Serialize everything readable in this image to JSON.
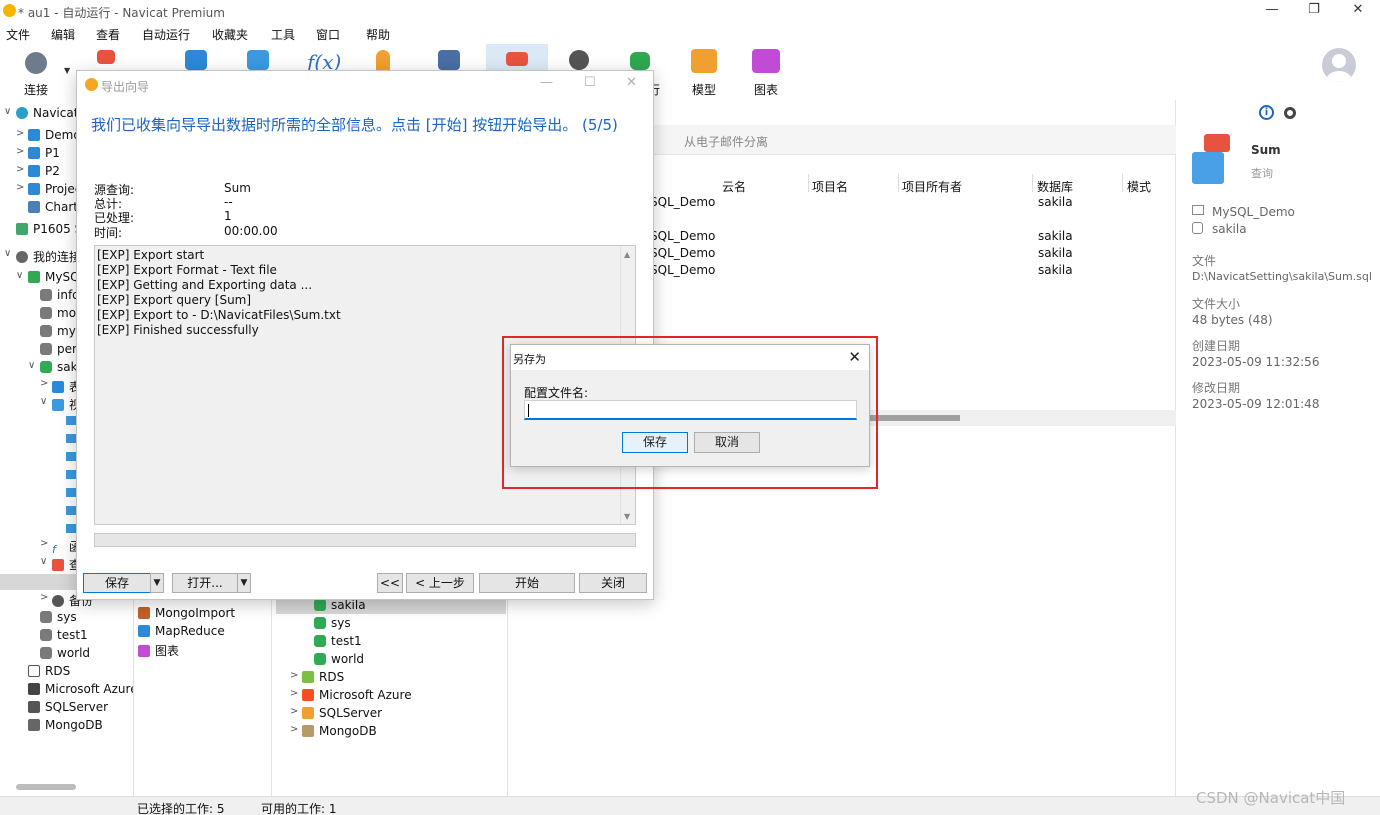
{
  "window": {
    "title": "* au1 - 自动运行 - Navicat Premium",
    "min": "—",
    "max": "❐",
    "close": "✕"
  },
  "menu": [
    "文件",
    "编辑",
    "查看",
    "自动运行",
    "收藏夹",
    "工具",
    "窗口",
    "帮助"
  ],
  "toolbar": {
    "connect": "连接",
    "run": "行",
    "model": "模型",
    "chart": "图表"
  },
  "nav": {
    "items": [
      {
        "label": "Navicat",
        "chevron": "∨"
      },
      {
        "label": "Demo",
        "chevron": ">"
      },
      {
        "label": "P1",
        "chevron": ">"
      },
      {
        "label": "P2",
        "chevron": ">"
      },
      {
        "label": "Projec",
        "chevron": ">"
      },
      {
        "label": "Chart",
        "chevron": ""
      },
      {
        "label": "P1605 S",
        "chevron": ""
      },
      {
        "label": "我的连接",
        "chevron": "∨"
      },
      {
        "label": "MySQL",
        "chevron": "∨"
      },
      {
        "label": "info",
        "chevron": ""
      },
      {
        "label": "mo",
        "chevron": ""
      },
      {
        "label": "my",
        "chevron": ""
      },
      {
        "label": "per",
        "chevron": ""
      },
      {
        "label": "sak",
        "chevron": "∨"
      },
      {
        "label": "表",
        "chevron": ">"
      },
      {
        "label": "视",
        "chevron": "∨"
      },
      {
        "label": "函",
        "chevron": ">"
      },
      {
        "label": "查",
        "chevron": "∨"
      },
      {
        "label": "备份",
        "chevron": ">"
      },
      {
        "label": "sys",
        "chevron": ""
      },
      {
        "label": "test1",
        "chevron": ""
      },
      {
        "label": "world",
        "chevron": ""
      },
      {
        "label": "RDS",
        "chevron": ""
      },
      {
        "label": "Microsoft Azure",
        "chevron": ""
      },
      {
        "label": "SQLServer",
        "chevron": ""
      },
      {
        "label": "MongoDB",
        "chevron": ""
      }
    ]
  },
  "objects": {
    "items": [
      "MongoImport",
      "MapReduce",
      "图表"
    ]
  },
  "panel2": {
    "items": [
      {
        "label": "sakila",
        "chevron": ""
      },
      {
        "label": "sys",
        "chevron": ""
      },
      {
        "label": "test1",
        "chevron": ""
      },
      {
        "label": "world",
        "chevron": ""
      },
      {
        "label": "RDS",
        "chevron": ">"
      },
      {
        "label": "Microsoft Azure",
        "chevron": ">"
      },
      {
        "label": "SQLServer",
        "chevron": ">"
      },
      {
        "label": "MongoDB",
        "chevron": ">"
      }
    ]
  },
  "main": {
    "toolbar_text": "从电子邮件分离",
    "columns": [
      "云名",
      "项目名",
      "项目所有者",
      "数据库",
      "模式"
    ],
    "rows": [
      {
        "conn": "SQL_Demo",
        "db": "sakila"
      },
      {
        "conn": "SQL_Demo",
        "db": "sakila"
      },
      {
        "conn": "SQL_Demo",
        "db": "sakila"
      },
      {
        "conn": "SQL_Demo",
        "db": "sakila"
      }
    ]
  },
  "info": {
    "name": "Sum",
    "type": "查询",
    "connection": "MySQL_Demo",
    "database": "sakila",
    "file_label": "文件",
    "file_value": "D:\\NavicatSetting\\sakila\\Sum.sql",
    "size_label": "文件大小",
    "size_value": "48 bytes (48)",
    "created_label": "创建日期",
    "created_value": "2023-05-09 11:32:56",
    "modified_label": "修改日期",
    "modified_value": "2023-05-09 12:01:48"
  },
  "status": {
    "selected": "已选择的工作: 5",
    "available": "可用的工作: 1"
  },
  "watermark": "CSDN @Navicat中国",
  "wizard": {
    "title": "导出向导",
    "heading": "我们已收集向导导出数据时所需的全部信息。点击 [开始] 按钮开始导出。 (5/5)",
    "summary": [
      {
        "key": "源查询:",
        "value": "Sum"
      },
      {
        "key": "总计:",
        "value": "--"
      },
      {
        "key": "已处理:",
        "value": "1"
      },
      {
        "key": "时间:",
        "value": "00:00.00"
      }
    ],
    "log": [
      "[EXP] Export start",
      "[EXP] Export Format - Text file",
      "[EXP] Getting and Exporting data ...",
      "[EXP] Export query [Sum]",
      "[EXP] Export to - D:\\NavicatFiles\\Sum.txt",
      "[EXP] Finished successfully"
    ],
    "progress": 0,
    "buttons": {
      "save": "保存",
      "open": "打开...",
      "first": "<<",
      "back": "< 上一步",
      "start": "开始",
      "close": "关闭"
    }
  },
  "saveas": {
    "title": "另存为",
    "label": "配置文件名:",
    "value": "",
    "save": "保存",
    "cancel": "取消",
    "close": "✕"
  },
  "colors": {
    "accent": "#1a64c6",
    "highlight": "#e2262a",
    "focus": "#0078d7"
  }
}
